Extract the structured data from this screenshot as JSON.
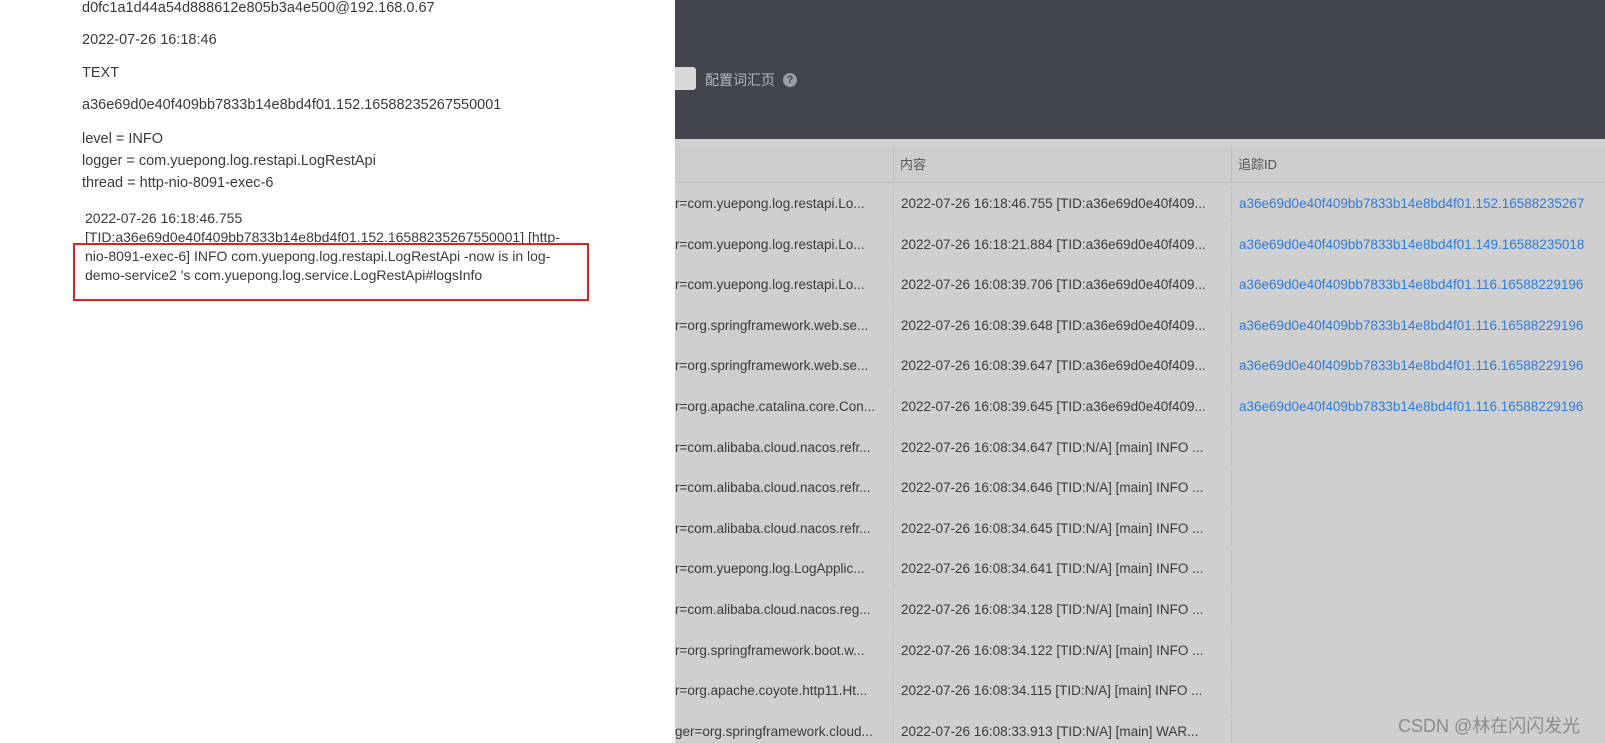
{
  "detail": {
    "host": "d0fc1a1d44a54d888612e805b3a4e500@192.168.0.67",
    "time": "2022-07-26 16:18:46",
    "type": "TEXT",
    "trace_id": "a36e69d0e40f409bb7833b14e8bd4f01.152.16588235267550001",
    "level": "level = INFO",
    "logger": "logger = com.yuepong.log.restapi.LogRestApi",
    "thread": "thread = http-nio-8091-exec-6",
    "message_lines": [
      "2022-07-26 16:18:46.755",
      "[TID:a36e69d0e40f409bb7833b14e8bd4f01.152.16588235267550001] [http-",
      "nio-8091-exec-6] INFO  com.yuepong.log.restapi.LogRestApi -now is in log-",
      "demo-service2  's com.yuepong.log.service.LogRestApi#logsInfo"
    ]
  },
  "toolbar": {
    "vocab_link": "配置词汇页",
    "help_icon": "?"
  },
  "table": {
    "headers": {
      "content": "内容",
      "trace": "追踪ID"
    },
    "rows": [
      {
        "logger": "r=com.yuepong.log.restapi.Lo...",
        "content": "2022-07-26 16:18:46.755 [TID:a36e69d0e40f409...",
        "trace": "a36e69d0e40f409bb7833b14e8bd4f01.152.16588235267"
      },
      {
        "logger": "r=com.yuepong.log.restapi.Lo...",
        "content": "2022-07-26 16:18:21.884 [TID:a36e69d0e40f409...",
        "trace": "a36e69d0e40f409bb7833b14e8bd4f01.149.16588235018"
      },
      {
        "logger": "r=com.yuepong.log.restapi.Lo...",
        "content": "2022-07-26 16:08:39.706 [TID:a36e69d0e40f409...",
        "trace": "a36e69d0e40f409bb7833b14e8bd4f01.116.16588229196"
      },
      {
        "logger": "r=org.springframework.web.se...",
        "content": "2022-07-26 16:08:39.648 [TID:a36e69d0e40f409...",
        "trace": "a36e69d0e40f409bb7833b14e8bd4f01.116.16588229196"
      },
      {
        "logger": "r=org.springframework.web.se...",
        "content": "2022-07-26 16:08:39.647 [TID:a36e69d0e40f409...",
        "trace": "a36e69d0e40f409bb7833b14e8bd4f01.116.16588229196"
      },
      {
        "logger": "r=org.apache.catalina.core.Con...",
        "content": "2022-07-26 16:08:39.645 [TID:a36e69d0e40f409...",
        "trace": "a36e69d0e40f409bb7833b14e8bd4f01.116.16588229196"
      },
      {
        "logger": "r=com.alibaba.cloud.nacos.refr...",
        "content": "2022-07-26 16:08:34.647 [TID:N/A] [main] INFO ...",
        "trace": ""
      },
      {
        "logger": "r=com.alibaba.cloud.nacos.refr...",
        "content": "2022-07-26 16:08:34.646 [TID:N/A] [main] INFO ...",
        "trace": ""
      },
      {
        "logger": "r=com.alibaba.cloud.nacos.refr...",
        "content": "2022-07-26 16:08:34.645 [TID:N/A] [main] INFO ...",
        "trace": ""
      },
      {
        "logger": "r=com.yuepong.log.LogApplic...",
        "content": "2022-07-26 16:08:34.641 [TID:N/A] [main] INFO ...",
        "trace": ""
      },
      {
        "logger": "r=com.alibaba.cloud.nacos.reg...",
        "content": "2022-07-26 16:08:34.128 [TID:N/A] [main] INFO ...",
        "trace": ""
      },
      {
        "logger": "r=org.springframework.boot.w...",
        "content": "2022-07-26 16:08:34.122 [TID:N/A] [main] INFO ...",
        "trace": ""
      },
      {
        "logger": "r=org.apache.coyote.http11.Ht...",
        "content": "2022-07-26 16:08:34.115 [TID:N/A] [main] INFO ...",
        "trace": ""
      },
      {
        "logger": "ger=org.springframework.cloud...",
        "content": "2022-07-26 16:08:33.913 [TID:N/A] [main] WAR...",
        "trace": ""
      }
    ]
  },
  "watermark": "CSDN @林在闪闪发光",
  "colors": {
    "highlight": "#e02020",
    "link": "#2f7bd9",
    "topbar": "#42454d"
  }
}
